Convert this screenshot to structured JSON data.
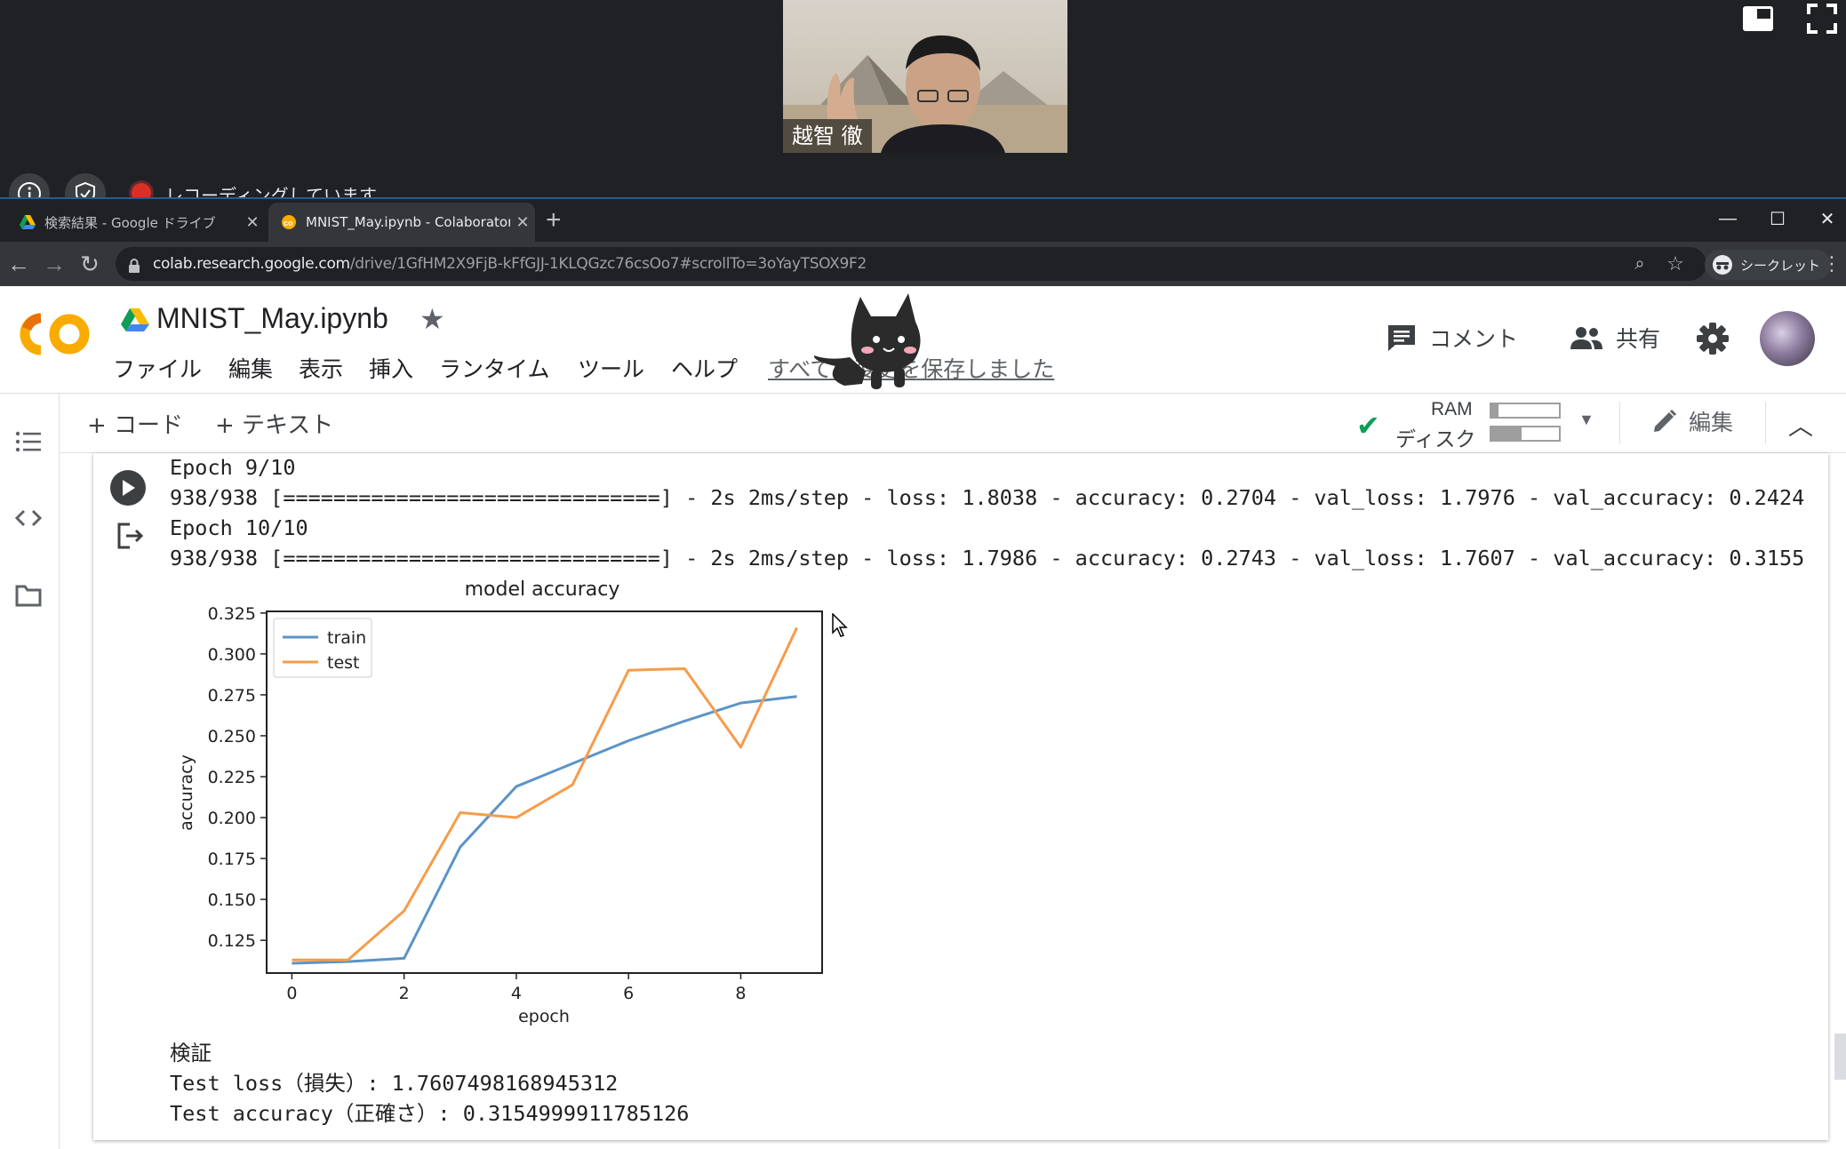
{
  "meeting": {
    "participant_name": "越智 徹",
    "recording_label": "レコーディングしています"
  },
  "browser": {
    "tabs": [
      {
        "title": "検索結果 - Google ドライブ",
        "active": false
      },
      {
        "title": "MNIST_May.ipynb - Colaboratory",
        "active": true
      }
    ],
    "url_host": "colab.research.google.com",
    "url_path": "/drive/1GfHM2X9FjB-kFfGJJ-1KLQGzc76csOo7#scrollTo=3oYayTSOX9F2",
    "profile_label": "シークレット"
  },
  "colab": {
    "notebook_title": "MNIST_May.ipynb",
    "menu": [
      "ファイル",
      "編集",
      "表示",
      "挿入",
      "ランタイム",
      "ツール",
      "ヘルプ"
    ],
    "save_status": "すべての変更を保存しました",
    "comment_label": "コメント",
    "share_label": "共有",
    "toolbar": {
      "add_code": "+ コード",
      "add_text": "+ テキスト",
      "ram_label": "RAM",
      "disk_label": "ディスク",
      "ram_usage": 0.1,
      "disk_usage": 0.45,
      "edit_label": "編集"
    }
  },
  "output": {
    "lines_before": [
      "Epoch 9/10",
      "938/938 [==============================] - 2s 2ms/step - loss: 1.8038 - accuracy: 0.2704 - val_loss: 1.7976 - val_accuracy: 0.2424",
      "Epoch 10/10",
      "938/938 [==============================] - 2s 2ms/step - loss: 1.7986 - accuracy: 0.2743 - val_loss: 1.7607 - val_accuracy: 0.3155"
    ],
    "lines_after": [
      "検証",
      "Test loss（損失）: 1.7607498168945312",
      "Test accuracy（正確さ）: 0.3154999911785126"
    ]
  },
  "chart_data": {
    "type": "line",
    "title": "model accuracy",
    "xlabel": "epoch",
    "ylabel": "accuracy",
    "x": [
      0,
      1,
      2,
      3,
      4,
      5,
      6,
      7,
      8,
      9
    ],
    "xlim": [
      -0.45,
      9.45
    ],
    "ylim": [
      0.105,
      0.326
    ],
    "xticks": [
      0,
      2,
      4,
      6,
      8
    ],
    "yticks": [
      0.125,
      0.15,
      0.175,
      0.2,
      0.225,
      0.25,
      0.275,
      0.3,
      0.325
    ],
    "ytick_labels": [
      "0.125",
      "0.150",
      "0.175",
      "0.200",
      "0.225",
      "0.250",
      "0.275",
      "0.300",
      "0.325"
    ],
    "legend_position": "top-left",
    "grid": false,
    "series": [
      {
        "name": "train",
        "color": "#5b94c6",
        "values": [
          0.111,
          0.112,
          0.114,
          0.182,
          0.219,
          0.233,
          0.247,
          0.259,
          0.27,
          0.274
        ]
      },
      {
        "name": "test",
        "color": "#f59c4a",
        "values": [
          0.113,
          0.113,
          0.143,
          0.203,
          0.2,
          0.22,
          0.29,
          0.291,
          0.243,
          0.316
        ]
      }
    ]
  }
}
